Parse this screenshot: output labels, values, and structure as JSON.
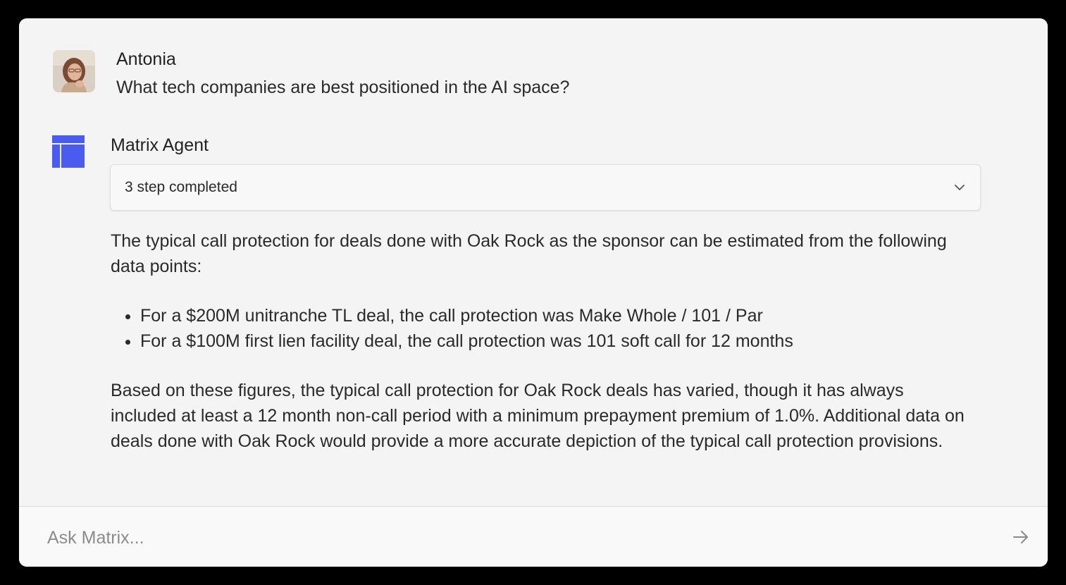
{
  "user_message": {
    "author": "Antonia",
    "text": "What tech companies are best positioned in the AI space?",
    "avatar_icon": "user-avatar"
  },
  "agent_message": {
    "author": "Matrix Agent",
    "logo_icon": "matrix-logo-icon",
    "logo_color": "#4a5cf0",
    "steps_label": "3 step completed",
    "intro": "The typical call protection for deals done with Oak Rock as the sponsor can be estimated from the following data points:",
    "bullets": [
      "For a $200M unitranche TL deal, the call protection was Make Whole / 101 / Par",
      "For a $100M first lien facility deal, the call protection was 101 soft call for 12 months"
    ],
    "conclusion": "Based on these figures, the typical call protection for Oak Rock deals has varied, though it has always included at least a 12 month non-call period with a minimum prepayment premium of 1.0%. Additional data on deals done with Oak Rock would provide a more accurate depiction of the typical call protection provisions."
  },
  "composer": {
    "placeholder": "Ask Matrix...",
    "value": "",
    "send_icon": "arrow-right-icon"
  }
}
